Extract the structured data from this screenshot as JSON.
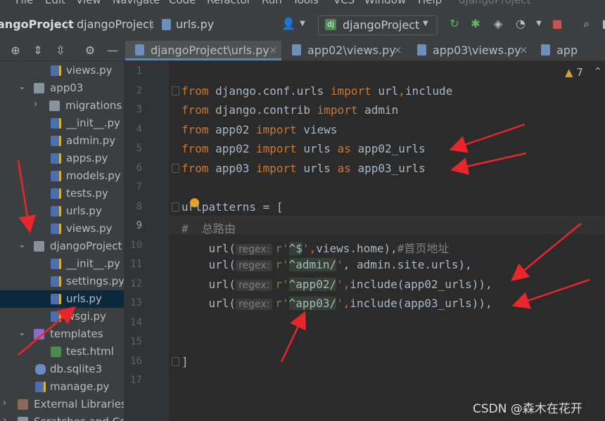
{
  "menu": [
    "File",
    "Edit",
    "View",
    "Navigate",
    "Code",
    "Refactor",
    "Run",
    "Tools",
    "VCS",
    "Window",
    "Help",
    "djangoProject"
  ],
  "breadcrumb": {
    "root": "angoProject",
    "folder": "djangoProject",
    "file": "urls.py"
  },
  "run_config": "djangoProject",
  "tabs": [
    {
      "label": "djangoProject\\urls.py",
      "active": true
    },
    {
      "label": "app02\\views.py",
      "active": false
    },
    {
      "label": "app03\\views.py",
      "active": false
    },
    {
      "label": "app",
      "active": false
    }
  ],
  "tree": [
    {
      "label": "views.py",
      "type": "py"
    },
    {
      "label": "app03",
      "type": "folder"
    },
    {
      "label": "migrations",
      "type": "folder"
    },
    {
      "label": "__init__.py",
      "type": "py"
    },
    {
      "label": "admin.py",
      "type": "py"
    },
    {
      "label": "apps.py",
      "type": "py"
    },
    {
      "label": "models.py",
      "type": "py"
    },
    {
      "label": "tests.py",
      "type": "py"
    },
    {
      "label": "urls.py",
      "type": "py"
    },
    {
      "label": "views.py",
      "type": "py"
    },
    {
      "label": "djangoProject",
      "type": "folder"
    },
    {
      "label": "__init__.py",
      "type": "py"
    },
    {
      "label": "settings.py",
      "type": "py"
    },
    {
      "label": "urls.py",
      "type": "py",
      "selected": true
    },
    {
      "label": "wsgi.py",
      "type": "py"
    },
    {
      "label": "templates",
      "type": "folder"
    },
    {
      "label": "test.html",
      "type": "html"
    },
    {
      "label": "db.sqlite3",
      "type": "db"
    },
    {
      "label": "manage.py",
      "type": "py"
    },
    {
      "label": "External Libraries",
      "type": "lib"
    },
    {
      "label": "Scratches and Co",
      "type": "scratch"
    }
  ],
  "line_numbers": [
    "1",
    "2",
    "3",
    "4",
    "5",
    "6",
    "7",
    "8",
    "9",
    "10",
    "11",
    "12",
    "13",
    "14",
    "15",
    "16",
    "17"
  ],
  "code": {
    "l2": {
      "k1": "from",
      "mod": " django.conf.urls ",
      "k2": "import",
      "rest": " url",
      "comma": ",",
      "rest2": "include"
    },
    "l3": {
      "k1": "from",
      "mod": " django.contrib ",
      "k2": "import",
      "rest": " admin"
    },
    "l4": {
      "k1": "from",
      "mod": " app02 ",
      "k2": "import",
      "rest": " views"
    },
    "l5": {
      "k1": "from",
      "mod": " app02 ",
      "k2": "import",
      "rest": " urls ",
      "k3": "as",
      "alias": " app02_urls"
    },
    "l6": {
      "k1": "from",
      "mod": " app03 ",
      "k2": "import",
      "rest": " urls ",
      "k3": "as",
      "alias": " app03_urls"
    },
    "l8": {
      "a": "u",
      "b": "rlpatterns = ["
    },
    "l9": {
      "text": "#  总路由"
    },
    "l10": {
      "fn": "    url(",
      "hint": "regex:",
      "pre": "r'",
      "rgx": "^$",
      "post": "'",
      "comma": ",",
      "rest": "views.home),",
      "cm": "#首页地址"
    },
    "l11": {
      "fn": "    url(",
      "hint": "regex:",
      "pre": "r'",
      "rgx": "^admin/",
      "post": "'",
      "rest": ", admin.site.urls),"
    },
    "l12": {
      "fn": "    url(",
      "hint": "regex:",
      "pre": "r'",
      "rgx": "^app02/",
      "post": "'",
      "comma": ",",
      "rest": "include(app02_urls)),"
    },
    "l13": {
      "fn": "    url(",
      "hint": "regex:",
      "pre": "r'",
      "rgx": "^app03/",
      "post": "'",
      "comma": ",",
      "rest": "include(app03_urls)),"
    },
    "l16": {
      "text": "]"
    }
  },
  "warnings": {
    "icon": "warning-icon",
    "count": "7"
  },
  "watermark": "CSDN @森木在花开",
  "colors": {
    "keyword": "#cc7832",
    "string": "#6a8759",
    "comment": "#808080",
    "arrow": "#e8262b",
    "selection": "#0d293e"
  }
}
